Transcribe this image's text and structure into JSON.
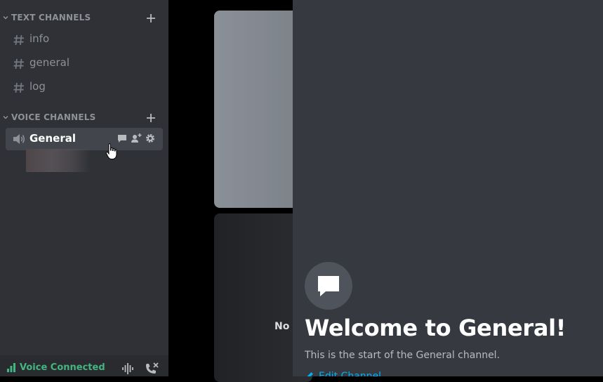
{
  "sidebar": {
    "text_category": "TEXT CHANNELS",
    "voice_category": "VOICE CHANNELS",
    "text_channels": [
      {
        "label": "info"
      },
      {
        "label": "general"
      },
      {
        "label": "log"
      }
    ],
    "voice_channel": {
      "label": "General"
    }
  },
  "voice_panel": {
    "status": "Voice Connected",
    "status_color": "#43b581"
  },
  "stage": {
    "tile_text": "No c"
  },
  "chat": {
    "welcome_title": "Welcome to General!",
    "welcome_subtitle": "This is the start of the General channel.",
    "edit_link": "Edit Channel"
  },
  "colors": {
    "sidebar_bg": "#2f3136",
    "chat_bg": "#36393f",
    "selected_bg": "#42454b",
    "link": "#00b0f4"
  },
  "icons": [
    "chevron-down-icon",
    "plus-icon",
    "hash-icon",
    "speaker-icon",
    "chat-bubble-icon",
    "add-user-icon",
    "gear-icon",
    "signal-bars-icon",
    "soundwave-icon",
    "hangup-icon",
    "pencil-icon",
    "hand-cursor-icon"
  ]
}
